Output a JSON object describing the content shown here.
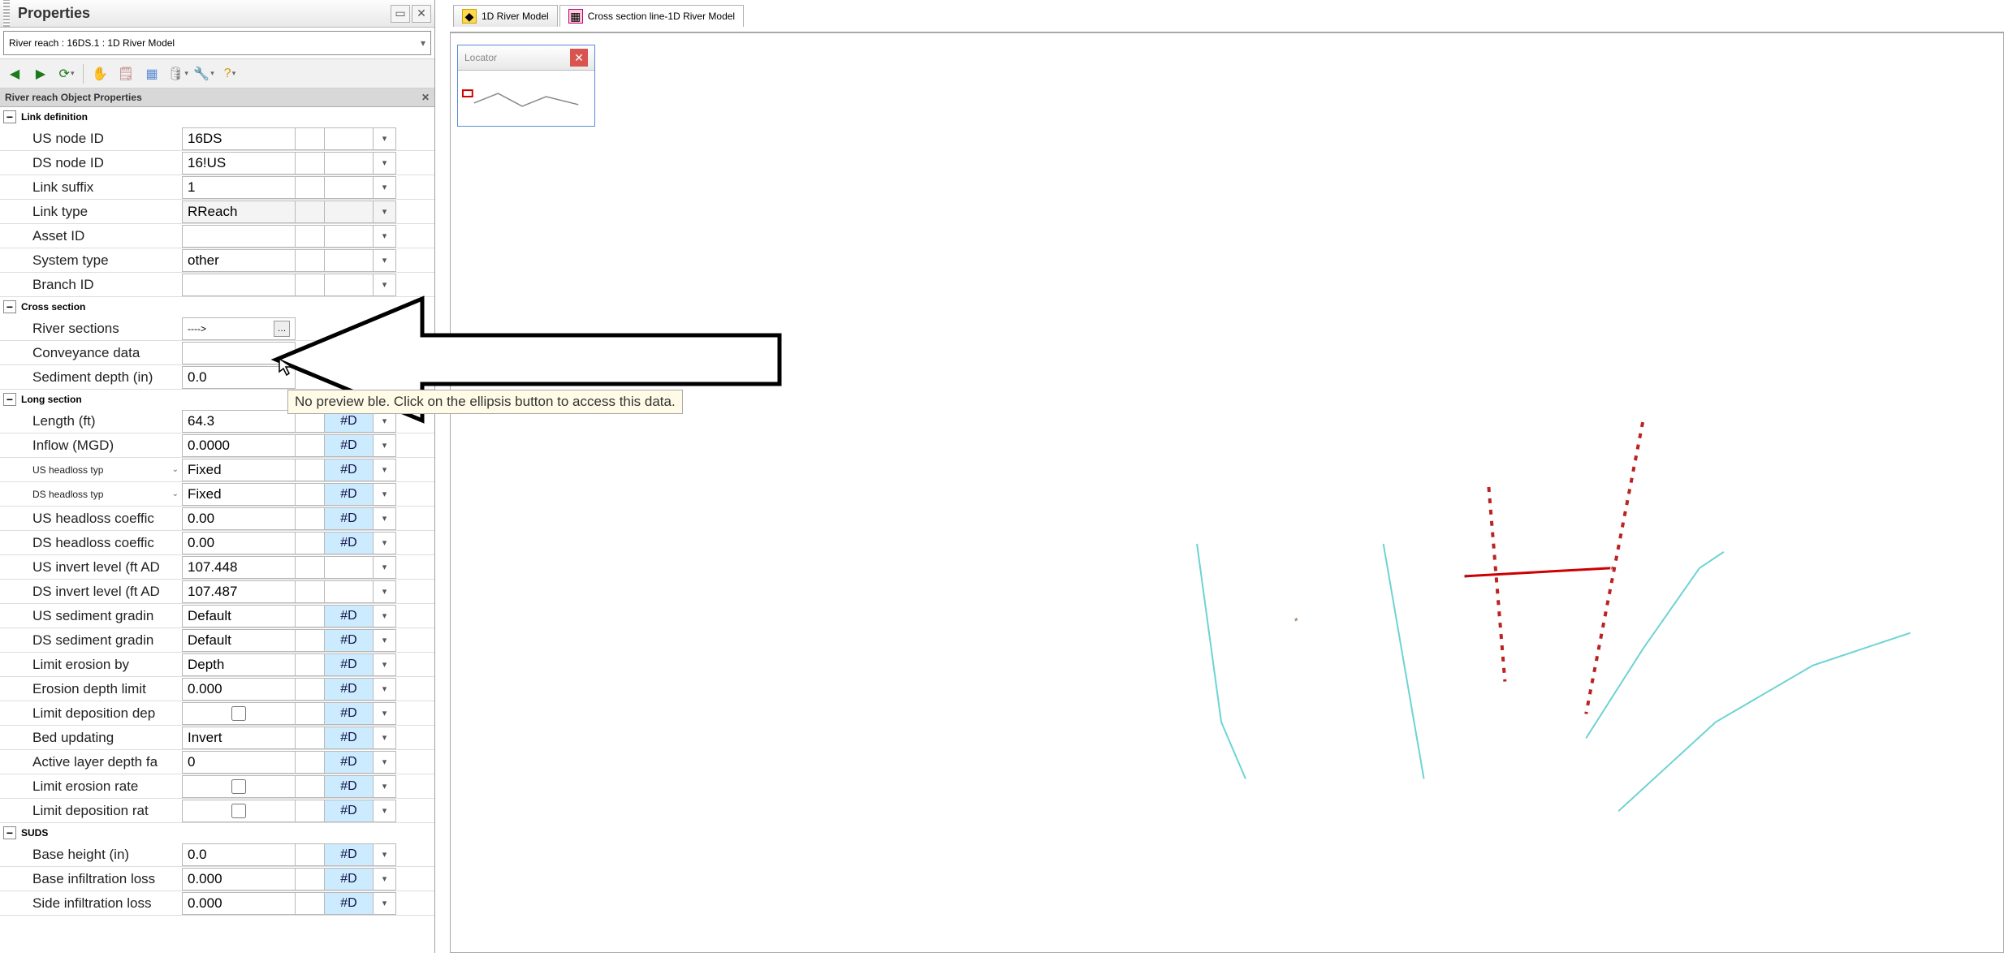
{
  "panel": {
    "title": "Properties",
    "selector": "River reach : 16DS.1 : 1D River Model",
    "section_header": "River reach Object Properties"
  },
  "tabs": {
    "t1": "1D River Model",
    "t2": "Cross section line-1D River Model"
  },
  "locator": {
    "title": "Locator"
  },
  "tooltip": "No preview         ble. Click on the ellipsis button to access this data.",
  "groups": {
    "link_def": "Link definition",
    "cross": "Cross section",
    "long": "Long section",
    "suds": "SUDS"
  },
  "flag_d": "#D",
  "props": {
    "us_node_id": {
      "label": "US node ID",
      "value": "16DS"
    },
    "ds_node_id": {
      "label": "DS node ID",
      "value": "16!US"
    },
    "link_suffix": {
      "label": "Link suffix",
      "value": "1"
    },
    "link_type": {
      "label": "Link type",
      "value": "RReach"
    },
    "asset_id": {
      "label": "Asset ID",
      "value": ""
    },
    "system_type": {
      "label": "System type",
      "value": "other"
    },
    "branch_id": {
      "label": "Branch ID",
      "value": ""
    },
    "river_sections": {
      "label": "River sections",
      "value": "---->"
    },
    "conveyance": {
      "label": "Conveyance data",
      "value": ""
    },
    "sediment_depth": {
      "label": "Sediment depth (in)",
      "value": "0.0"
    },
    "length": {
      "label": "Length (ft)",
      "value": "64.3"
    },
    "inflow": {
      "label": "Inflow (MGD)",
      "value": "0.0000"
    },
    "us_headloss_type": {
      "label": "US headloss typ",
      "value": "Fixed"
    },
    "ds_headloss_type": {
      "label": "DS headloss typ",
      "value": "Fixed"
    },
    "us_headloss_coef": {
      "label": "US headloss coeffic",
      "value": "0.00"
    },
    "ds_headloss_coef": {
      "label": "DS headloss coeffic",
      "value": "0.00"
    },
    "us_invert": {
      "label": "US invert level (ft AD",
      "value": "107.448"
    },
    "ds_invert": {
      "label": "DS invert level (ft AD",
      "value": "107.487"
    },
    "us_sed_grad": {
      "label": "US sediment gradin",
      "value": "Default"
    },
    "ds_sed_grad": {
      "label": "DS sediment gradin",
      "value": "Default"
    },
    "limit_erosion_by": {
      "label": "Limit erosion by",
      "value": "Depth"
    },
    "erosion_depth_limit": {
      "label": "Erosion depth limit",
      "value": "0.000"
    },
    "limit_dep_depth": {
      "label": "Limit deposition dep"
    },
    "bed_updating": {
      "label": "Bed updating",
      "value": "Invert"
    },
    "active_layer_depth": {
      "label": "Active layer depth fa",
      "value": "0"
    },
    "limit_erosion_rate": {
      "label": "Limit erosion rate"
    },
    "limit_dep_rate": {
      "label": "Limit deposition rat"
    },
    "base_height": {
      "label": "Base height (in)",
      "value": "0.0"
    },
    "base_infil": {
      "label": "Base infiltration loss",
      "value": "0.000"
    },
    "side_infil": {
      "label": "Side infiltration loss",
      "value": "0.000"
    }
  }
}
